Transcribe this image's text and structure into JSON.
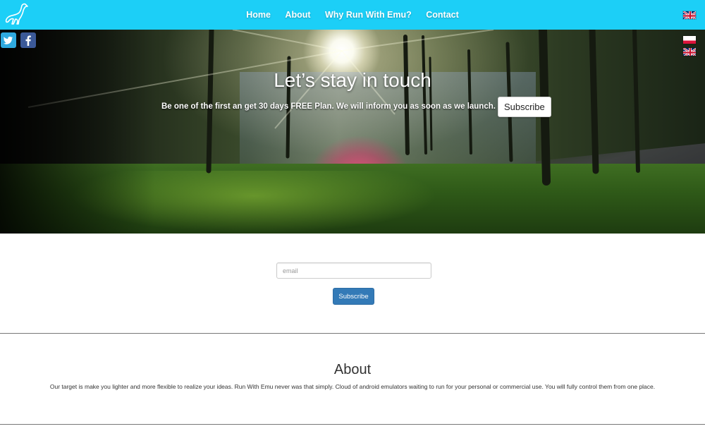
{
  "nav": {
    "brand": "emu-logo",
    "links": [
      "Home",
      "About",
      "Why Run With Emu?",
      "Contact"
    ],
    "language_flag": "gb-flag-icon"
  },
  "hero": {
    "title": "Let’s stay in touch",
    "text": "Be one of the first an get 30 days FREE Plan. We will inform you as soon as we launch.",
    "subscribe_label": "Subscribe",
    "social": [
      "twitter-icon",
      "facebook-icon"
    ],
    "language_flags": [
      "pl-flag-icon",
      "gb-flag-icon"
    ]
  },
  "form": {
    "email_placeholder": "email",
    "email_value": "",
    "subscribe_label": "Subscribe"
  },
  "about": {
    "title": "About",
    "text": "Our target is make you lighter and more flexible to realize your ideas. Run With Emu never was that simply. Cloud of android emulators waiting to run for your personal or commercial use. You will fully control them from one place."
  },
  "colors": {
    "navbar": "#1ccff7",
    "primary_button": "#337ab7",
    "twitter": "#2fa9df",
    "facebook": "#3b5998"
  }
}
